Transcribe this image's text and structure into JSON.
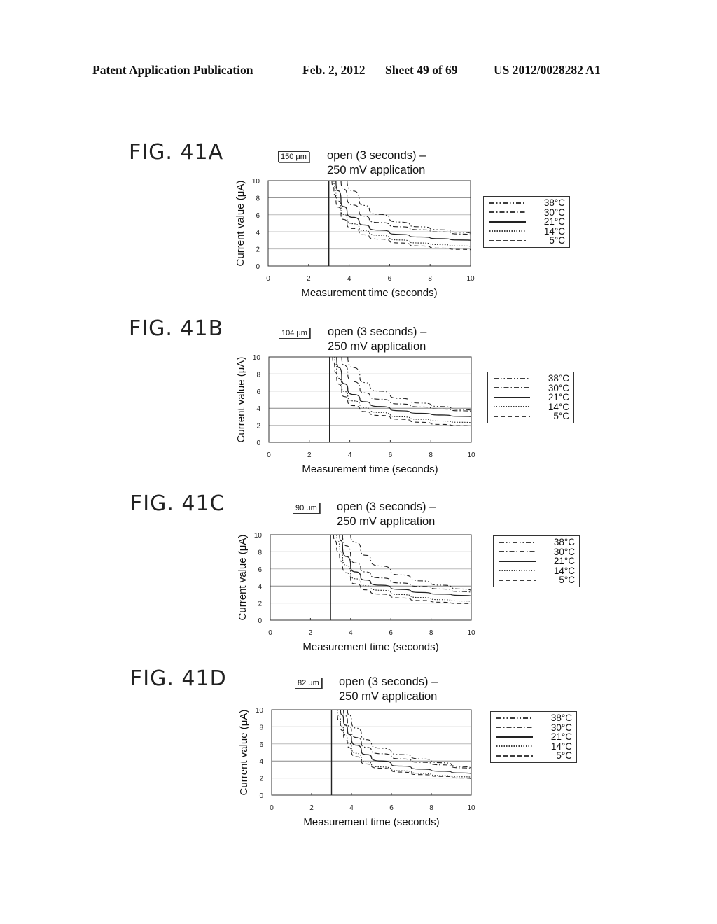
{
  "header": {
    "publication": "Patent Application Publication",
    "date": "Feb. 2, 2012",
    "sheet": "Sheet 49 of 69",
    "number": "US 2012/0028282 A1"
  },
  "legend_entries": [
    {
      "label": "38°C",
      "style": "dash-dot-dot"
    },
    {
      "label": "30°C",
      "style": "dash-dot"
    },
    {
      "label": "21°C",
      "style": "solid"
    },
    {
      "label": "14°C",
      "style": "dotted"
    },
    {
      "label": "5°C",
      "style": "dashed"
    }
  ],
  "panels": [
    {
      "fig": "FIG. 41A",
      "unit": "150 μm",
      "cond_line1": "open (3 seconds) –",
      "cond_line2": "250 mV application"
    },
    {
      "fig": "FIG. 41B",
      "unit": "104 μm",
      "cond_line1": "open (3 seconds) –",
      "cond_line2": "250 mV application"
    },
    {
      "fig": "FIG. 41C",
      "unit": "90 μm",
      "cond_line1": "open (3 seconds) –",
      "cond_line2": "250 mV application"
    },
    {
      "fig": "FIG. 41D",
      "unit": "82 μm",
      "cond_line1": "open (3 seconds) –",
      "cond_line2": "250 mV application"
    }
  ],
  "chart_data": [
    {
      "type": "line",
      "title": "open (3 seconds) – 250 mV application",
      "subtitle": "150 μm",
      "xlabel": "Measurement time (seconds)",
      "ylabel": "Current value (μA)",
      "xlim": [
        0,
        10
      ],
      "ylim": [
        0,
        10
      ],
      "xticks": [
        0,
        2,
        4,
        6,
        8,
        10
      ],
      "yticks": [
        0,
        2,
        4,
        6,
        8,
        10
      ],
      "grid": "horizontal",
      "vline": 3,
      "legend": "right",
      "x": [
        3.15,
        3.25,
        3.35,
        3.6,
        3.9,
        4.5,
        5,
        6,
        7,
        8,
        9,
        10
      ],
      "series": [
        {
          "name": "38°C",
          "values": [
            null,
            null,
            null,
            null,
            10,
            7.6,
            6.6,
            5.5,
            4.8,
            4.4,
            4.1,
            3.8
          ]
        },
        {
          "name": "30°C",
          "values": [
            null,
            null,
            null,
            10,
            8.0,
            6.3,
            5.4,
            4.8,
            4.4,
            4.1,
            3.9,
            3.6
          ]
        },
        {
          "name": "21°C",
          "values": [
            null,
            null,
            10,
            7.6,
            6.3,
            5.1,
            4.5,
            3.9,
            3.5,
            3.3,
            3.1,
            3.0
          ]
        },
        {
          "name": "14°C",
          "values": [
            null,
            10,
            8.6,
            6.6,
            5.5,
            4.4,
            3.9,
            3.3,
            2.8,
            2.6,
            2.4,
            2.3
          ]
        },
        {
          "name": "5°C",
          "values": [
            10,
            8.8,
            7.8,
            6.0,
            4.9,
            3.9,
            3.4,
            2.9,
            2.5,
            2.2,
            2.0,
            1.9
          ]
        }
      ]
    },
    {
      "type": "line",
      "title": "open (3 seconds) – 250 mV application",
      "subtitle": "104 μm",
      "xlabel": "Measurement time (seconds)",
      "ylabel": "Current value (μA)",
      "xlim": [
        0,
        10
      ],
      "ylim": [
        0,
        10
      ],
      "xticks": [
        0,
        2,
        4,
        6,
        8,
        10
      ],
      "yticks": [
        0,
        2,
        4,
        6,
        8,
        10
      ],
      "grid": "horizontal",
      "vline": 3,
      "legend": "right",
      "x": [
        3.15,
        3.25,
        3.35,
        3.6,
        3.9,
        4.5,
        5,
        6,
        7,
        8,
        9,
        10
      ],
      "series": [
        {
          "name": "38°C",
          "values": [
            null,
            null,
            null,
            null,
            10,
            7.5,
            6.5,
            5.5,
            4.8,
            4.4,
            4.0,
            3.7
          ]
        },
        {
          "name": "30°C",
          "values": [
            null,
            null,
            null,
            10,
            8.0,
            6.2,
            5.4,
            4.7,
            4.3,
            4.0,
            3.8,
            3.6
          ]
        },
        {
          "name": "21°C",
          "values": [
            null,
            null,
            10,
            7.5,
            6.2,
            5.0,
            4.5,
            3.9,
            3.5,
            3.3,
            3.1,
            3.0
          ]
        },
        {
          "name": "14°C",
          "values": [
            null,
            10,
            8.5,
            6.5,
            5.4,
            4.3,
            3.8,
            3.2,
            2.8,
            2.6,
            2.4,
            2.3
          ]
        },
        {
          "name": "5°C",
          "values": [
            10,
            8.7,
            7.7,
            5.9,
            4.8,
            3.8,
            3.4,
            2.9,
            2.5,
            2.2,
            2.0,
            1.9
          ]
        }
      ]
    },
    {
      "type": "line",
      "title": "open (3 seconds) – 250 mV application",
      "subtitle": "90 μm",
      "xlabel": "Measurement time (seconds)",
      "ylabel": "Current value (μA)",
      "xlim": [
        0,
        10
      ],
      "ylim": [
        0,
        10
      ],
      "xticks": [
        0,
        2,
        4,
        6,
        8,
        10
      ],
      "yticks": [
        0,
        2,
        4,
        6,
        8,
        10
      ],
      "grid": "horizontal",
      "vline": 3,
      "legend": "right",
      "x": [
        3.15,
        3.3,
        3.45,
        3.6,
        4.0,
        4.5,
        5,
        6,
        7,
        8,
        9,
        10
      ],
      "series": [
        {
          "name": "38°C",
          "values": [
            null,
            null,
            null,
            null,
            10,
            8.2,
            7.0,
            5.7,
            4.9,
            4.3,
            3.9,
            3.4
          ]
        },
        {
          "name": "30°C",
          "values": [
            null,
            null,
            null,
            10,
            7.4,
            6.0,
            5.3,
            4.6,
            4.1,
            3.8,
            3.5,
            3.2
          ]
        },
        {
          "name": "21°C",
          "values": [
            null,
            null,
            10,
            8.6,
            6.3,
            5.0,
            4.4,
            3.8,
            3.4,
            3.1,
            3.0,
            2.8
          ]
        },
        {
          "name": "14°C",
          "values": [
            null,
            10,
            8.5,
            7.4,
            5.4,
            4.3,
            3.8,
            3.2,
            2.8,
            2.5,
            2.3,
            2.2
          ]
        },
        {
          "name": "5°C",
          "values": [
            10,
            8.6,
            7.4,
            6.4,
            4.7,
            3.8,
            3.3,
            2.8,
            2.4,
            2.2,
            2.0,
            1.9
          ]
        }
      ]
    },
    {
      "type": "line",
      "title": "open (3 seconds) – 250 mV application",
      "subtitle": "82 μm",
      "xlabel": "Measurement time (seconds)",
      "ylabel": "Current value (μA)",
      "xlim": [
        0,
        10
      ],
      "ylim": [
        0,
        10
      ],
      "xticks": [
        0,
        2,
        4,
        6,
        8,
        10
      ],
      "yticks": [
        0,
        2,
        4,
        6,
        8,
        10
      ],
      "grid": "horizontal",
      "vline": 3,
      "legend": "right",
      "x": [
        3.3,
        3.45,
        3.6,
        3.8,
        4.0,
        4.5,
        5,
        6,
        7,
        8,
        9,
        10
      ],
      "series": [
        {
          "name": "38°C",
          "values": [
            null,
            null,
            null,
            10,
            8.7,
            7.0,
            6.0,
            5.0,
            4.5,
            4.0,
            3.6,
            3.1
          ]
        },
        {
          "name": "30°C",
          "values": [
            null,
            null,
            10,
            8.6,
            7.5,
            6.0,
            5.2,
            4.5,
            4.0,
            3.7,
            3.4,
            3.0
          ]
        },
        {
          "name": "21°C",
          "values": [
            null,
            10,
            8.8,
            7.6,
            6.6,
            5.1,
            4.4,
            3.6,
            3.2,
            2.9,
            2.7,
            2.5
          ]
        },
        {
          "name": "14°C",
          "values": [
            10,
            8.6,
            7.6,
            6.5,
            5.6,
            4.2,
            3.6,
            3.0,
            2.7,
            2.4,
            2.2,
            2.1
          ]
        },
        {
          "name": "5°C",
          "values": [
            9.3,
            8.1,
            7.1,
            6.0,
            5.1,
            3.9,
            3.4,
            2.9,
            2.5,
            2.3,
            2.1,
            1.9
          ]
        }
      ]
    }
  ]
}
